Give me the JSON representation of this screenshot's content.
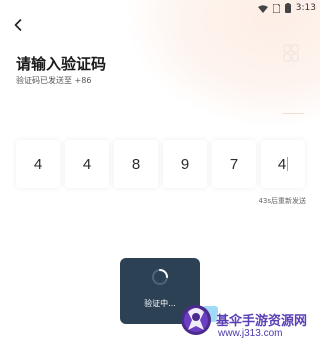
{
  "status_bar": {
    "time": "3:13",
    "icons": [
      "wifi-icon",
      "sim-card-icon",
      "battery-icon"
    ]
  },
  "header": {
    "back_icon": "chevron-left-icon"
  },
  "page": {
    "title": "请输入验证码",
    "subtitle": "验证码已发送至 +86"
  },
  "code": {
    "digits": [
      "4",
      "4",
      "8",
      "9",
      "7",
      "4"
    ],
    "active_index": 5
  },
  "resend": {
    "label": "43s后重新发送"
  },
  "loading": {
    "text": "验证中..."
  },
  "watermark": {
    "title": "基伞手游资源网",
    "url": "www.j313.com"
  },
  "colors": {
    "accent": "#e88b6c",
    "loading_bg": "#2d4154",
    "watermark": "#5a3fb5"
  }
}
